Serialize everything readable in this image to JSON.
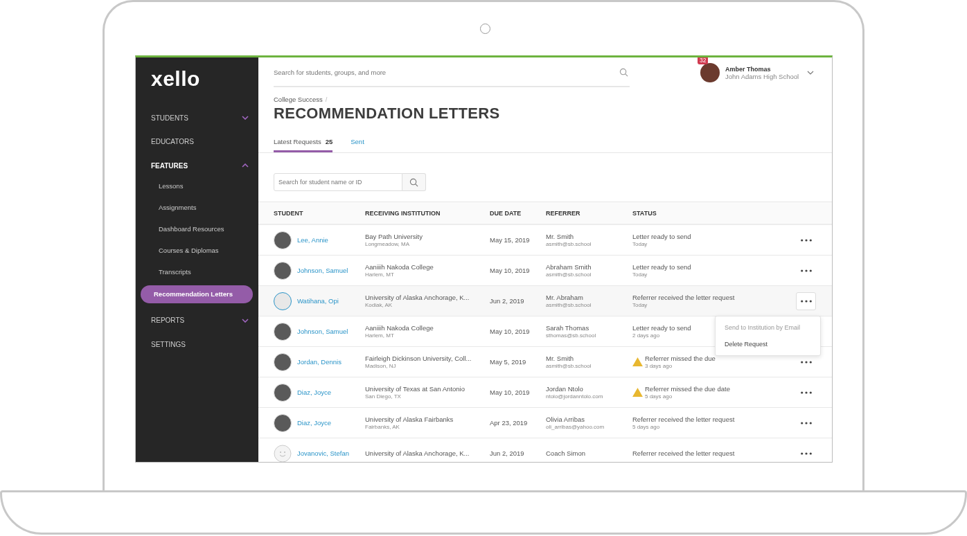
{
  "sidebar": {
    "logo": "xello",
    "items": [
      {
        "label": "STUDENTS",
        "kind": "group",
        "expanded": false
      },
      {
        "label": "EDUCATORS",
        "kind": "link"
      },
      {
        "label": "FEATURES",
        "kind": "group",
        "expanded": true,
        "children": [
          {
            "label": "Lessons",
            "selected": false
          },
          {
            "label": "Assignments",
            "selected": false
          },
          {
            "label": "Dashboard Resources",
            "selected": false
          },
          {
            "label": "Courses & Diplomas",
            "selected": false
          },
          {
            "label": "Transcripts",
            "selected": false
          },
          {
            "label": "Recommendation Letters",
            "selected": true
          }
        ]
      },
      {
        "label": "REPORTS",
        "kind": "group",
        "expanded": false
      },
      {
        "label": "SETTINGS",
        "kind": "link"
      }
    ]
  },
  "topbar": {
    "search": {
      "placeholder": "Search for students, groups, and more"
    },
    "user": {
      "badge": "32",
      "name": "Amber Thomas",
      "school": "John Adams High School"
    }
  },
  "breadcrumb": {
    "label": "College Success",
    "separator": "/"
  },
  "title": "RECOMMENDATION LETTERS",
  "tabs": [
    {
      "label": "Latest Requests",
      "count": "25",
      "selected": true
    },
    {
      "label": "Sent",
      "selected": false
    }
  ],
  "student_search": {
    "placeholder": "Search for student name or ID"
  },
  "table": {
    "columns": [
      "STUDENT",
      "RECEIVING INSTITUTION",
      "DUE DATE",
      "REFERRER",
      "STATUS"
    ],
    "rows": [
      {
        "kind": "photo",
        "student": "Lee, Annie",
        "institution": "Bay Path University",
        "location": "Longmeadow, MA",
        "due": "May 15, 2019",
        "referrer": "Mr. Smith",
        "email": "asmith@sb.school",
        "status": "Letter ready to send",
        "when": "Today",
        "warning": false,
        "selected": false
      },
      {
        "kind": "photo",
        "student": "Johnson, Samuel",
        "institution": "Aaniiih Nakoda College",
        "location": "Harlem, MT",
        "due": "May 10, 2019",
        "referrer": "Abraham Smith",
        "email": "asmith@sb.school",
        "status": "Letter ready to send",
        "when": "Today",
        "warning": false,
        "selected": false
      },
      {
        "kind": "photo",
        "student": "Watihana, Opi",
        "institution": "University of Alaska Anchorage, K...",
        "location": "Kodiak, AK",
        "due": "Jun 2, 2019",
        "referrer": "Mr. Abraham",
        "email": "asmith@sb.school",
        "status": "Referrer received the letter request",
        "when": "Today",
        "warning": false,
        "selected": true,
        "menu": [
          {
            "label": "Send to Institution by Email",
            "disabled": true
          },
          {
            "label": "Delete Request",
            "disabled": false
          }
        ]
      },
      {
        "kind": "photo",
        "student": "Johnson, Samuel",
        "institution": "Aaniiih Nakoda College",
        "location": "Harlem, MT",
        "due": "May 10, 2019",
        "referrer": "Sarah Thomas",
        "email": "sthomas@sb.school",
        "status": "Letter ready to send",
        "when": "2 days ago",
        "warning": false,
        "selected": false
      },
      {
        "kind": "photo",
        "student": "Jordan, Dennis",
        "institution": "Fairleigh Dickinson University, Coll...",
        "location": "Madison, NJ",
        "due": "May 5, 2019",
        "referrer": "Mr. Smith",
        "email": "asmith@sb.school",
        "status": "Referrer missed the due",
        "when": "3 days ago",
        "warning": true,
        "selected": false
      },
      {
        "kind": "photo",
        "student": "Diaz, Joyce",
        "institution": "University of Texas at San Antonio",
        "location": "San Diego, TX",
        "due": "May 10, 2019",
        "referrer": "Jordan Ntolo",
        "email": "ntolo@jordanntolo.com",
        "status": "Referrer missed the due date",
        "when": "5 days ago",
        "warning": true,
        "selected": false
      },
      {
        "kind": "photo",
        "student": "Diaz, Joyce",
        "institution": "University of Alaska Fairbanks",
        "location": "Fairbanks, AK",
        "due": "Apr 23, 2019",
        "referrer": "Olivia Arribas",
        "email": "oli_arribas@yahoo.com",
        "status": "Referrer received the letter request",
        "when": "5 days ago",
        "warning": false,
        "selected": false
      },
      {
        "kind": "placeholder",
        "student": "Jovanovic, Stefan",
        "institution": "University of Alaska Anchorage, K...",
        "due": "Jun 2, 2019",
        "referrer": "Coach Simon",
        "status": "Referrer received the letter request",
        "warning": false,
        "selected": false
      }
    ]
  }
}
